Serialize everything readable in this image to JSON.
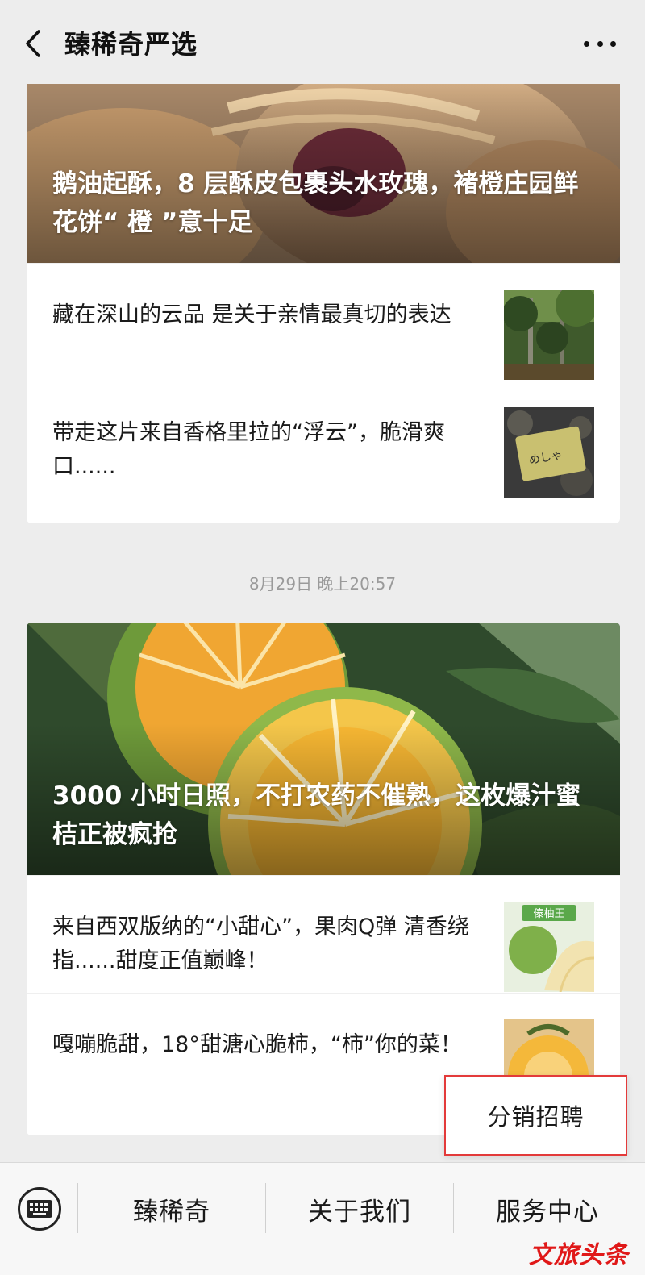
{
  "header": {
    "title": "臻稀奇严选",
    "back_icon": "chevron-left-icon",
    "more_icon": "more-dots-icon"
  },
  "messages": [
    {
      "hero_title": "鹅油起酥，8 层酥皮包裹头水玫瑰，褚橙庄园鲜花饼“ 橙 ”意十足",
      "items": [
        {
          "text": "藏在深山的云品 是关于亲情最真切的表达"
        },
        {
          "text": "带走这片来自香格里拉的“浮云”，脆滑爽口......"
        }
      ]
    },
    {
      "timestamp": "8月29日 晚上20:57",
      "hero_title": "3000 小时日照，不打农药不催熟，这枚爆汁蜜桔正被疯抢",
      "items": [
        {
          "text": "来自西双版纳的“小甜心”，果肉Q弹 清香绕指......甜度正值巅峰！",
          "thumb_label": "傣柚王"
        },
        {
          "text": "嘎嘣脆甜，18°甜溏心脆柿，“柿”你的菜！"
        }
      ]
    }
  ],
  "popup_menu": {
    "items": [
      "分销招聘"
    ]
  },
  "bottom_menu": {
    "keyboard_icon": "keyboard-icon",
    "items": [
      "臻稀奇",
      "关于我们",
      "服务中心"
    ]
  },
  "watermark": "文旅头条",
  "colors": {
    "background": "#ededed",
    "highlight_border": "#e33a3a",
    "watermark": "#e01818"
  }
}
